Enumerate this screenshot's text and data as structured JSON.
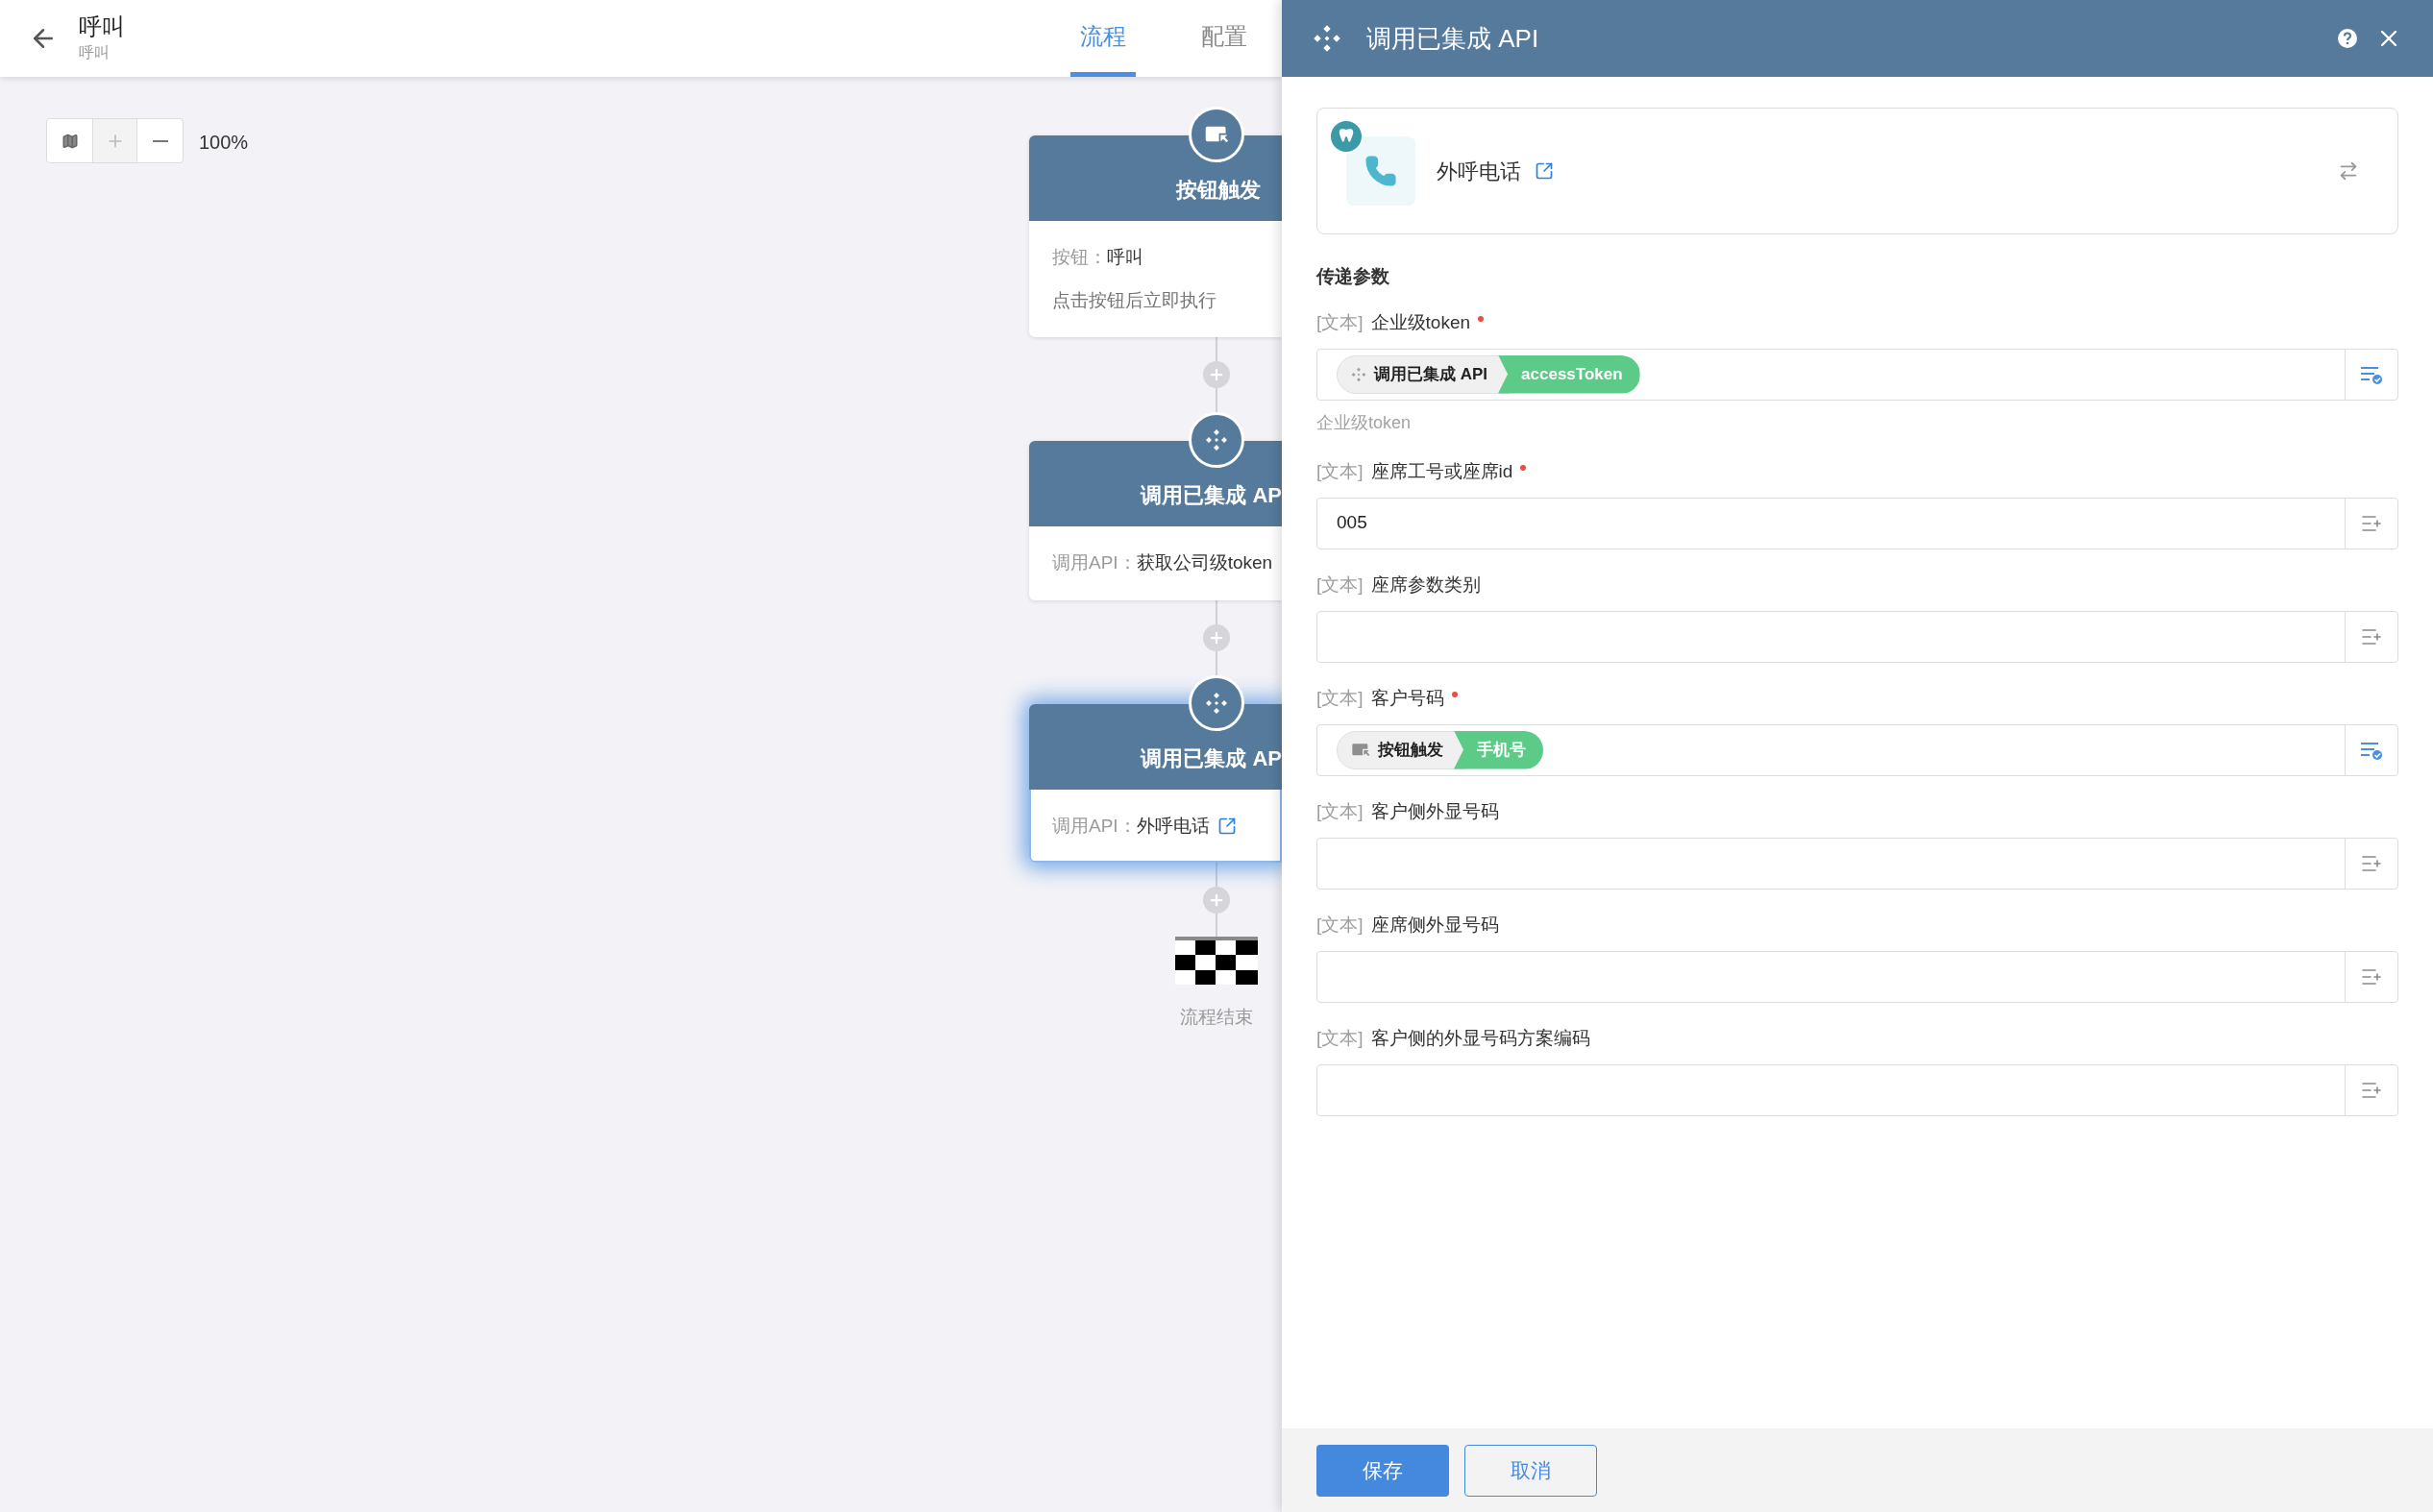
{
  "header": {
    "title": "呼叫",
    "subtitle": "呼叫"
  },
  "tabs": [
    {
      "label": "流程",
      "selected": true
    },
    {
      "label": "配置",
      "selected": false
    }
  ],
  "zoom": {
    "percent": "100%"
  },
  "nodes": [
    {
      "kind": "trigger",
      "title": "按钮触发",
      "selected": false,
      "lines": [
        {
          "label": "按钮：",
          "value": "呼叫"
        },
        {
          "label": "点击按钮后立即执行"
        }
      ]
    },
    {
      "kind": "api",
      "title": "调用已集成 AP",
      "selected": false,
      "lines": [
        {
          "label": "调用API：",
          "value": "获取公司级token"
        }
      ]
    },
    {
      "kind": "api",
      "title": "调用已集成 AP",
      "selected": true,
      "lines": [
        {
          "label": "调用API：",
          "value": "外呼电话",
          "link": true
        }
      ]
    }
  ],
  "end_label": "流程结束",
  "panel": {
    "title": "调用已集成 API",
    "app": {
      "name": "外呼电话"
    },
    "section_title": "传递参数",
    "fields": [
      {
        "kind": "chips",
        "tag": "[文本]",
        "label": "企业级token",
        "required": true,
        "chip": {
          "kind": "api",
          "source": "调用已集成 API",
          "field": "accessToken"
        },
        "hint": "企业级token"
      },
      {
        "kind": "input",
        "tag": "[文本]",
        "label": "座席工号或座席id",
        "required": true,
        "value": "005"
      },
      {
        "kind": "input",
        "tag": "[文本]",
        "label": "座席参数类别",
        "required": false
      },
      {
        "kind": "chips",
        "tag": "[文本]",
        "label": "客户号码",
        "required": true,
        "chip": {
          "kind": "trigger",
          "source": "按钮触发",
          "field": "手机号"
        }
      },
      {
        "kind": "input",
        "tag": "[文本]",
        "label": "客户侧外显号码",
        "required": false
      },
      {
        "kind": "input",
        "tag": "[文本]",
        "label": "座席侧外显号码",
        "required": false
      },
      {
        "kind": "input",
        "tag": "[文本]",
        "label": "客户侧的外显号码方案编码",
        "required": false
      }
    ],
    "buttons": [
      {
        "kind": "primary",
        "label": "保存"
      },
      {
        "kind": "secondary",
        "label": "取消"
      }
    ]
  }
}
